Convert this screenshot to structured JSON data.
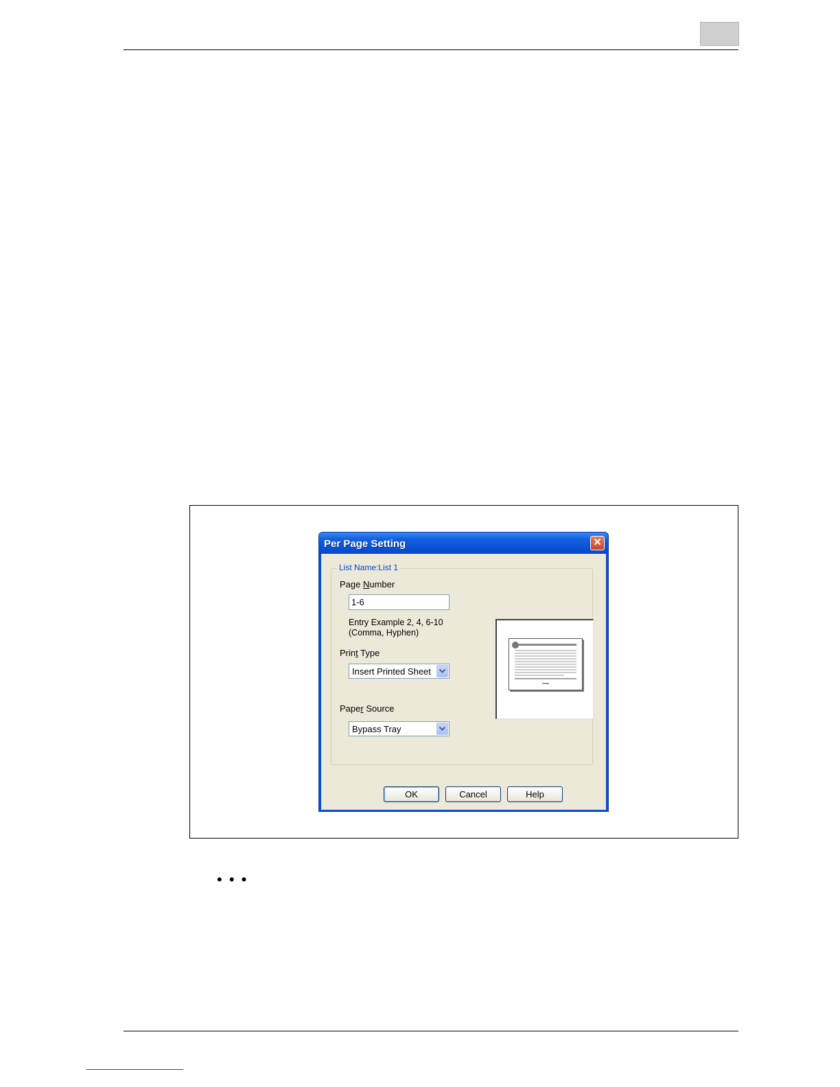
{
  "dialog": {
    "title": "Per Page Setting",
    "group_label": "List Name:List 1",
    "page_number": {
      "label_pre": "Page ",
      "label_accel": "N",
      "label_post": "umber",
      "value": "1-6",
      "hint_line1": "Entry Example 2, 4, 6-10",
      "hint_line2": "(Comma, Hyphen)"
    },
    "print_type": {
      "label_pre": "Prin",
      "label_accel": "t",
      "label_post": " Type",
      "selected": "Insert Printed Sheet"
    },
    "paper_source": {
      "label_pre": "Pape",
      "label_accel": "r",
      "label_post": " Source",
      "selected": "Bypass Tray"
    },
    "buttons": {
      "ok": "OK",
      "cancel": "Cancel",
      "help": "Help"
    }
  },
  "page": {
    "continuation": "• • •"
  },
  "colors": {
    "titlebar": "#0a52d6",
    "dialog_face": "#ece9d8",
    "group_label": "#0046d5"
  }
}
